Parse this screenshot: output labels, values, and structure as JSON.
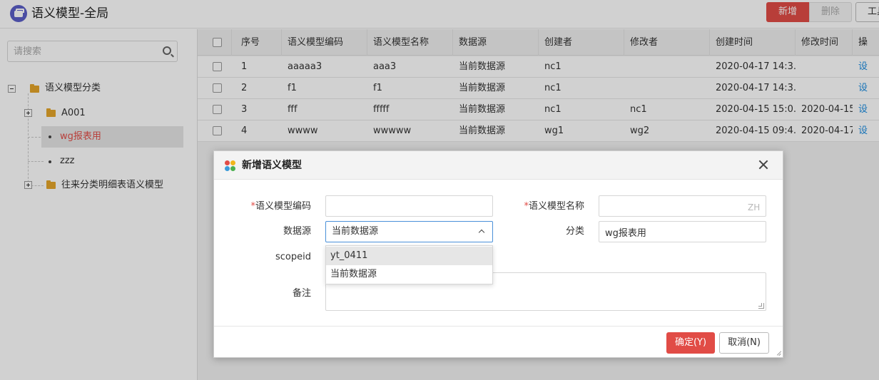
{
  "header": {
    "title": "语义模型-全局",
    "new_label": "新增",
    "delete_label": "删除",
    "tool_label": "工具"
  },
  "sidebar": {
    "search_placeholder": "请搜索",
    "tree": {
      "root": "语义模型分类",
      "items": [
        "A001",
        "wg报表用",
        "zzz",
        "往来分类明细表语义模型"
      ]
    }
  },
  "table": {
    "columns": [
      "序号",
      "语义模型编码",
      "语义模型名称",
      "数据源",
      "创建者",
      "修改者",
      "创建时间",
      "修改时间",
      "操"
    ],
    "rows": [
      {
        "no": "1",
        "code": "aaaaa3",
        "name": "aaa3",
        "source": "当前数据源",
        "creator": "nc1",
        "modifier": "",
        "created": "2020-04-17 14:3...",
        "modified": "",
        "op": "设"
      },
      {
        "no": "2",
        "code": "f1",
        "name": "f1",
        "source": "当前数据源",
        "creator": "nc1",
        "modifier": "",
        "created": "2020-04-17 14:3...",
        "modified": "",
        "op": "设"
      },
      {
        "no": "3",
        "code": "fff",
        "name": "fffff",
        "source": "当前数据源",
        "creator": "nc1",
        "modifier": "nc1",
        "created": "2020-04-15 15:0...",
        "modified": "2020-04-15 1",
        "op": "设"
      },
      {
        "no": "4",
        "code": "wwww",
        "name": "wwwww",
        "source": "当前数据源",
        "creator": "wg1",
        "modifier": "wg2",
        "created": "2020-04-15 09:4...",
        "modified": "2020-04-17 0",
        "op": "设"
      }
    ]
  },
  "dialog": {
    "title": "新增语义模型",
    "required_mark": "*",
    "code_label": "语义模型编码",
    "code_value": "",
    "name_label": "语义模型名称",
    "name_value": "",
    "name_lang_tag": "ZH",
    "source_label": "数据源",
    "source_value": "当前数据源",
    "category_label": "分类",
    "category_value": "wg报表用",
    "scope_label": "scopeid",
    "remark_label": "备注",
    "dropdown_options": [
      "yt_0411",
      "当前数据源"
    ],
    "ok_label": "确定(Y)",
    "cancel_label": "取消(N)"
  },
  "colors": {
    "accent": "#e14c46",
    "link": "#1a8ce0",
    "focus": "#4a90d9"
  }
}
